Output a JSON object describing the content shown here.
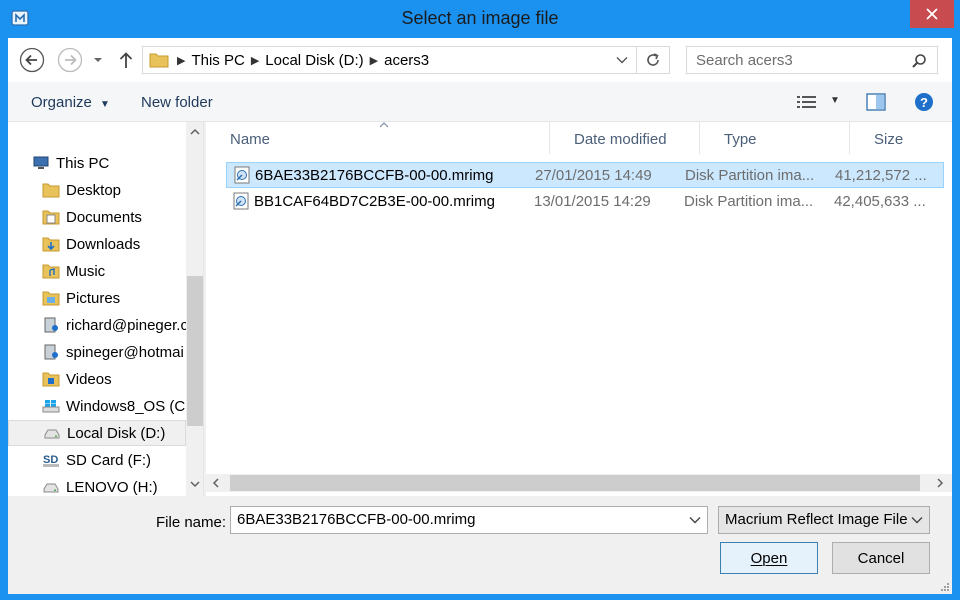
{
  "window": {
    "title": "Select an image file"
  },
  "navbar": {
    "breadcrumb": [
      "This PC",
      "Local Disk (D:)",
      "acers3"
    ],
    "search_placeholder": "Search acers3"
  },
  "toolbar": {
    "organize_label": "Organize",
    "new_folder_label": "New folder"
  },
  "navpane": {
    "items": [
      {
        "label": "This PC",
        "icon": "computer-icon"
      },
      {
        "label": "Desktop",
        "icon": "folder-icon"
      },
      {
        "label": "Documents",
        "icon": "documents-folder-icon"
      },
      {
        "label": "Downloads",
        "icon": "downloads-folder-icon"
      },
      {
        "label": "Music",
        "icon": "music-folder-icon"
      },
      {
        "label": "Pictures",
        "icon": "pictures-folder-icon"
      },
      {
        "label": "richard@pineger.c",
        "icon": "user-drive-icon"
      },
      {
        "label": "spineger@hotmai",
        "icon": "user-drive-icon"
      },
      {
        "label": "Videos",
        "icon": "videos-folder-icon"
      },
      {
        "label": "Windows8_OS (C:)",
        "icon": "windows-drive-icon"
      },
      {
        "label": "Local Disk (D:)",
        "icon": "disk-drive-icon"
      },
      {
        "label": "SD Card (F:)",
        "icon": "sd-card-icon"
      },
      {
        "label": "LENOVO (H:)",
        "icon": "disk-drive-icon"
      }
    ]
  },
  "filelist": {
    "columns": [
      "Name",
      "Date modified",
      "Type",
      "Size"
    ],
    "rows": [
      {
        "name": "6BAE33B2176BCCFB-00-00.mrimg",
        "date": "27/01/2015 14:49",
        "type": "Disk Partition ima...",
        "size": "41,212,572 ..."
      },
      {
        "name": "BB1CAF64BD7C2B3E-00-00.mrimg",
        "date": "13/01/2015 14:29",
        "type": "Disk Partition ima...",
        "size": "42,405,633 ..."
      }
    ]
  },
  "bottom": {
    "file_name_label": "File name:",
    "file_name_value": "6BAE33B2176BCCFB-00-00.mrimg",
    "file_type_value": "Macrium Reflect Image File",
    "open_label": "Open",
    "cancel_label": "Cancel"
  },
  "colors": {
    "titlebar": "#1c92f0",
    "selection": "#cce8ff",
    "close": "#c74b4f"
  }
}
